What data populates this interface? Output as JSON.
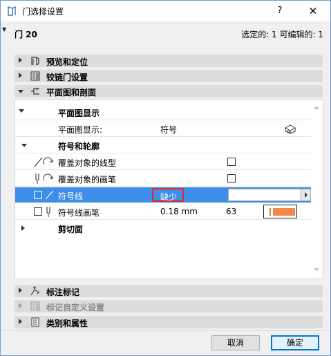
{
  "window": {
    "title": "门选择设置",
    "help_label": "?",
    "close_label": "✕",
    "icon": "app-icon"
  },
  "header": {
    "name": "门 20",
    "selection_info": "选定的: 1 可编辑的: 1"
  },
  "sections": {
    "preview": {
      "label": "预览和定位",
      "icon": "preview-icon",
      "expanded": false
    },
    "hinge": {
      "label": "铰链门设置",
      "icon": "hinge-door-icon",
      "expanded": false
    },
    "floor_plan": {
      "label": "平面图和剖面",
      "icon": "floor-plan-icon",
      "expanded": true
    },
    "dimension": {
      "label": "标注标记",
      "icon": "dimension-marker-icon",
      "expanded": false
    },
    "custom_marker": {
      "label": "标记自定义设置",
      "icon": "custom-marker-icon",
      "expanded": false,
      "disabled": true
    },
    "category": {
      "label": "类别和属性",
      "icon": "category-icon",
      "expanded": false
    }
  },
  "panel": {
    "group_display": {
      "label": "平面图显示"
    },
    "display_row": {
      "label": "平面图显示:",
      "value": "符号",
      "icon": "3d-box-icon"
    },
    "group_symbol": {
      "label": "符号和轮廓"
    },
    "override_linetype": {
      "label": "覆盖对象的线型",
      "checked": false
    },
    "override_pen": {
      "label": "覆盖对象的画笔",
      "checked": false
    },
    "symbol_line": {
      "label": "符号线",
      "value": "缺少",
      "checked": false
    },
    "symbol_pen": {
      "label": "符号线画笔",
      "value": "0.18 mm",
      "pen_number": "63",
      "pen_color": "#f0894a",
      "checked": false
    },
    "group_cut": {
      "label": "剪切面"
    }
  },
  "footer": {
    "cancel_label": "取消",
    "ok_label": "确定"
  }
}
